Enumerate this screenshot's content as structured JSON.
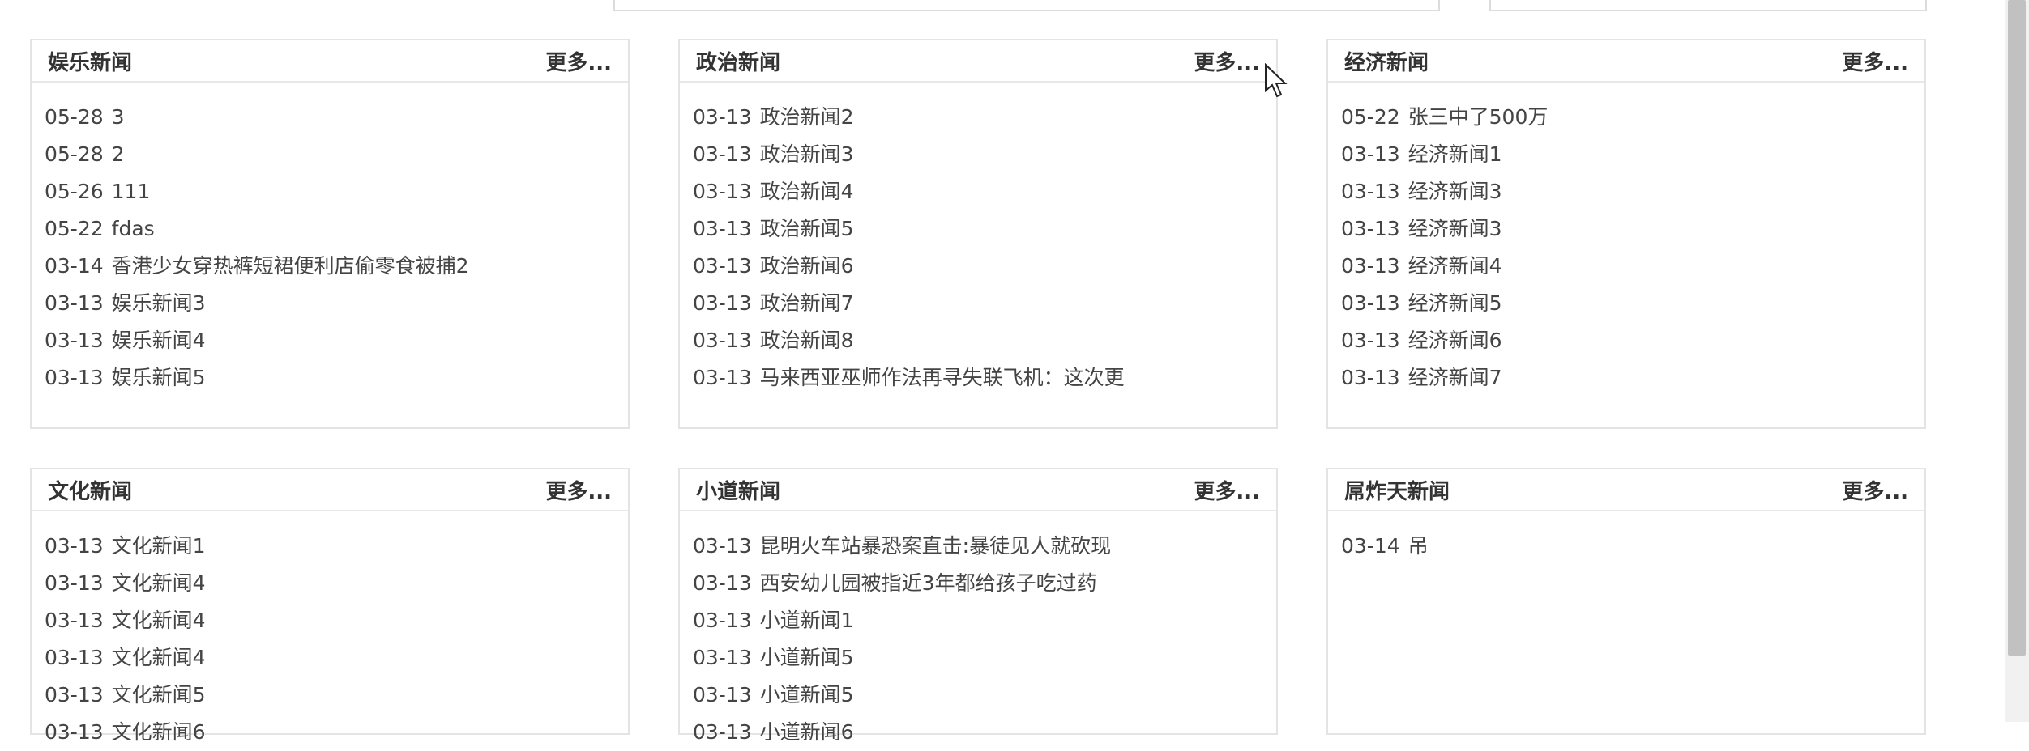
{
  "top_search": {
    "input1_placeholder": "",
    "input2_placeholder": ""
  },
  "boxes": [
    {
      "title": "娱乐新闻",
      "more": "更多...",
      "items": [
        {
          "date": "05-28",
          "title": "3"
        },
        {
          "date": "05-28",
          "title": "2"
        },
        {
          "date": "05-26",
          "title": "111"
        },
        {
          "date": "05-22",
          "title": "fdas"
        },
        {
          "date": "03-14",
          "title": "香港少女穿热裤短裙便利店偷零食被捕2"
        },
        {
          "date": "03-13",
          "title": "娱乐新闻3"
        },
        {
          "date": "03-13",
          "title": "娱乐新闻4"
        },
        {
          "date": "03-13",
          "title": "娱乐新闻5"
        }
      ]
    },
    {
      "title": "政治新闻",
      "more": "更多...",
      "items": [
        {
          "date": "03-13",
          "title": "政治新闻2"
        },
        {
          "date": "03-13",
          "title": "政治新闻3"
        },
        {
          "date": "03-13",
          "title": "政治新闻4"
        },
        {
          "date": "03-13",
          "title": "政治新闻5"
        },
        {
          "date": "03-13",
          "title": "政治新闻6"
        },
        {
          "date": "03-13",
          "title": "政治新闻7"
        },
        {
          "date": "03-13",
          "title": "政治新闻8"
        },
        {
          "date": "03-13",
          "title": "马来西亚巫师作法再寻失联飞机：这次更"
        }
      ]
    },
    {
      "title": "经济新闻",
      "more": "更多...",
      "items": [
        {
          "date": "05-22",
          "title": "张三中了500万"
        },
        {
          "date": "03-13",
          "title": "经济新闻1"
        },
        {
          "date": "03-13",
          "title": "经济新闻3"
        },
        {
          "date": "03-13",
          "title": "经济新闻3"
        },
        {
          "date": "03-13",
          "title": "经济新闻4"
        },
        {
          "date": "03-13",
          "title": "经济新闻5"
        },
        {
          "date": "03-13",
          "title": "经济新闻6"
        },
        {
          "date": "03-13",
          "title": "经济新闻7"
        }
      ]
    },
    {
      "title": "文化新闻",
      "more": "更多...",
      "items": [
        {
          "date": "03-13",
          "title": "文化新闻1"
        },
        {
          "date": "03-13",
          "title": "文化新闻4"
        },
        {
          "date": "03-13",
          "title": "文化新闻4"
        },
        {
          "date": "03-13",
          "title": "文化新闻4"
        },
        {
          "date": "03-13",
          "title": "文化新闻5"
        },
        {
          "date": "03-13",
          "title": "文化新闻6"
        }
      ]
    },
    {
      "title": "小道新闻",
      "more": "更多...",
      "items": [
        {
          "date": "03-13",
          "title": "昆明火车站暴恐案直击:暴徒见人就砍现"
        },
        {
          "date": "03-13",
          "title": "西安幼儿园被指近3年都给孩子吃过药"
        },
        {
          "date": "03-13",
          "title": "小道新闻1"
        },
        {
          "date": "03-13",
          "title": "小道新闻5"
        },
        {
          "date": "03-13",
          "title": "小道新闻5"
        },
        {
          "date": "03-13",
          "title": "小道新闻6"
        }
      ]
    },
    {
      "title": "屌炸天新闻",
      "more": "更多...",
      "items": [
        {
          "date": "03-14",
          "title": "吊"
        }
      ]
    }
  ]
}
